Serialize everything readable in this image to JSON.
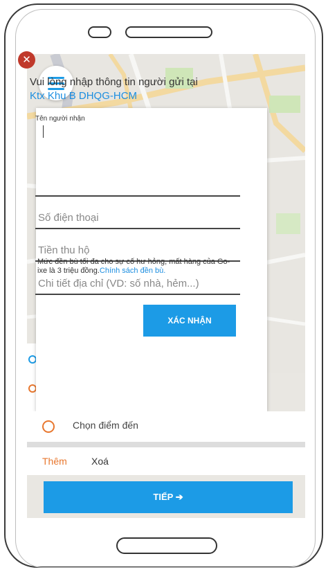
{
  "form": {
    "title": "Vui lòng nhập thông tin người gửi tại",
    "location": "Ktx Khu B DHQG-HCM",
    "receiver_label": "Tên người nhận",
    "receiver_value": "",
    "phone_placeholder": "Số điện thoại",
    "cod_placeholder": "Tiền thu hộ",
    "address_placeholder": "Chi tiết địa chỉ (VD: số nhà, hẻm...)",
    "note_text": "Mức đền bù tối đa cho sự cố hư hỏng, mất hàng của Go-ixe là 3 triệu đồng.",
    "policy_link": "Chính sách đền bù.",
    "confirm_label": "XÁC NHẬN",
    "close_glyph": "✕"
  },
  "route": {
    "destination_label": "Chọn điểm đến"
  },
  "actions": {
    "add_label": "Thêm",
    "delete_label": "Xoá"
  },
  "next_button": {
    "label": "TIẾP",
    "arrow": "➔"
  },
  "colors": {
    "accent": "#1c9be6",
    "link": "#1c8ee0",
    "close": "#c0392b",
    "orange": "#e8772e"
  },
  "icons": {
    "menu": "hamburger-icon",
    "close": "close-icon",
    "next": "arrow-right-icon"
  }
}
